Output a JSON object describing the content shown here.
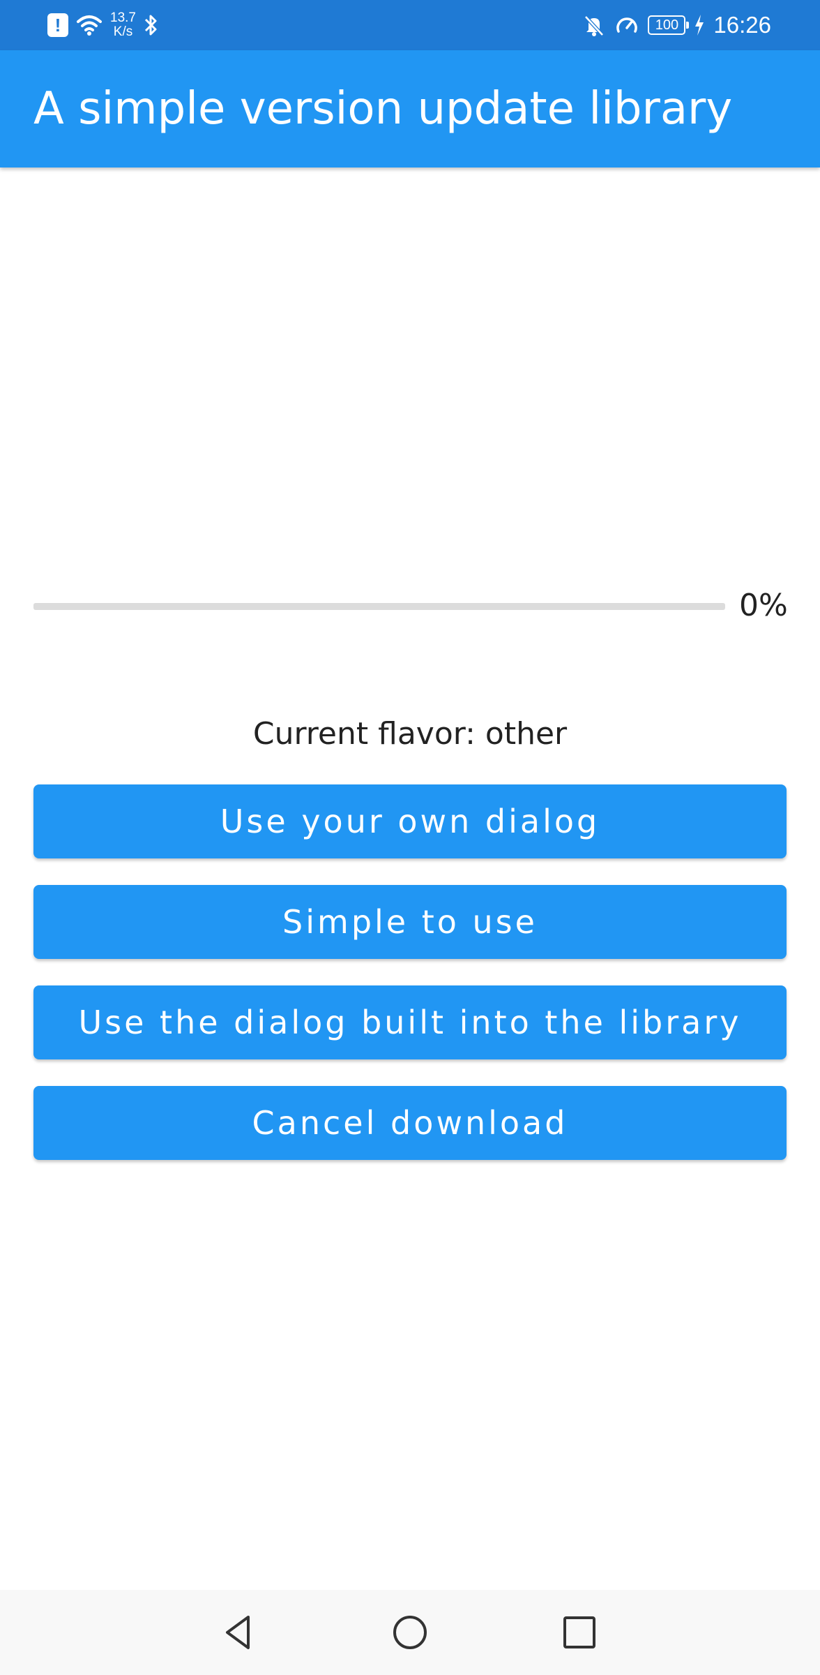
{
  "status_bar": {
    "net_speed_value": "13.7",
    "net_speed_unit": "K/s",
    "battery": "100",
    "time": "16:26",
    "icons": [
      "alert-icon",
      "wifi-icon",
      "bluetooth-icon",
      "bell-muted-icon",
      "speedometer-icon",
      "battery-icon",
      "charging-icon"
    ]
  },
  "app_bar": {
    "title": "A simple version update library",
    "color": "#2196f3"
  },
  "progress": {
    "value": 0,
    "label": "0%"
  },
  "flavor": {
    "label": "Current flavor:",
    "value": "other"
  },
  "buttons": {
    "own_dialog": "Use your own dialog",
    "simple": "Simple to use",
    "builtin_dialog": "Use the dialog built into the library",
    "cancel": "Cancel download"
  },
  "nav_bar": {
    "icons": [
      "back-icon",
      "home-icon",
      "recents-icon"
    ]
  },
  "colors": {
    "status_bar": "#1f7ad4",
    "primary": "#2196f3",
    "track": "#dcdcdc"
  }
}
